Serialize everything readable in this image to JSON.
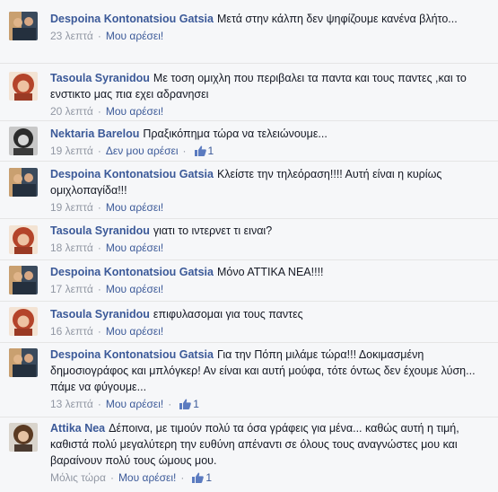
{
  "comments": [
    {
      "author": "Despoina Kontonatsiou Gatsia",
      "text": "Μετά στην κάλπη δεν ψηφίζουμε κανένα βλήτο...",
      "time": "23 λεπτά",
      "sep": "·",
      "like_label": "Μου αρέσει!",
      "like_count": "",
      "avatar": "despoina"
    },
    {
      "author": "Tasoula Syranidou",
      "text": "Με τοση ομιχλη που περιβαλει τα παντα και τους παντες ,και το ενστικτο μας πια εχει αδρανησει",
      "time": "20 λεπτά",
      "sep": "·",
      "like_label": "Μου αρέσει!",
      "like_count": "",
      "avatar": "tasoula"
    },
    {
      "author": "Nektaria Barelou",
      "text": "Πραξικόπημα τώρα να τελειώνουμε...",
      "time": "19 λεπτά",
      "sep": "·",
      "like_label": "Δεν μου αρέσει",
      "like_count": "1",
      "avatar": "nektaria"
    },
    {
      "author": "Despoina Kontonatsiou Gatsia",
      "text": "Κλείστε την τηλεόραση!!!! Αυτή είναι η κυρίως ομιχλοπαγίδα!!!",
      "time": "19 λεπτά",
      "sep": "·",
      "like_label": "Μου αρέσει!",
      "like_count": "",
      "avatar": "despoina"
    },
    {
      "author": "Tasoula Syranidou",
      "text": "γιατι το ιντερνετ τι ειναι?",
      "time": "18 λεπτά",
      "sep": "·",
      "like_label": "Μου αρέσει!",
      "like_count": "",
      "avatar": "tasoula"
    },
    {
      "author": "Despoina Kontonatsiou Gatsia",
      "text": "Μόνο ΑΤΤΙΚΑ ΝΕΑ!!!!",
      "time": "17 λεπτά",
      "sep": "·",
      "like_label": "Μου αρέσει!",
      "like_count": "",
      "avatar": "despoina"
    },
    {
      "author": "Tasoula Syranidou",
      "text": "επιφυλασομαι για τους παντες",
      "time": "16 λεπτά",
      "sep": "·",
      "like_label": "Μου αρέσει!",
      "like_count": "",
      "avatar": "tasoula"
    },
    {
      "author": "Despoina Kontonatsiou Gatsia",
      "text": "Για την Πόπη μιλάμε τώρα!!! Δοκιμασμένη δημοσιογράφος και μπλόγκερ! Αν είναι και αυτή μούφα, τότε όντως δεν έχουμε λύση... πάμε να φύγουμε...",
      "time": "13 λεπτά",
      "sep": "·",
      "like_label": "Μου αρέσει!",
      "like_count": "1",
      "avatar": "despoina"
    },
    {
      "author": "Attika Nea",
      "text": "Δέποινα, με τιμούν πολύ τα όσα γράφεις για μένα... καθώς αυτή η τιμή, καθιστά πολύ μεγαλύτερη την ευθύνη απέναντι σε όλους τους αναγνώστες μου και βαραίνουν πολύ τους ώμους μου.",
      "time": "Μόλις τώρα",
      "sep": "·",
      "like_label": "Μου αρέσει!",
      "like_count": "1",
      "avatar": "attika"
    }
  ],
  "colors": {
    "author": "#3b5998",
    "meta": "#9197a3",
    "background": "#f6f7f9",
    "text": "#141823"
  },
  "icons": {
    "like": "thumbs-up-icon"
  }
}
